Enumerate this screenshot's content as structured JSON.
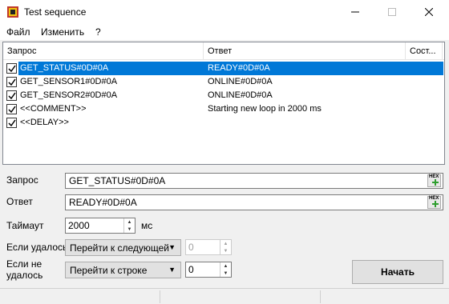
{
  "window": {
    "title": "Test sequence"
  },
  "menu": {
    "file": "Файл",
    "edit": "Изменить",
    "help": "?"
  },
  "list": {
    "columns": [
      "Запрос",
      "Ответ",
      "Сост..."
    ],
    "rows": [
      {
        "request": "GET_STATUS#0D#0A",
        "response": "READY#0D#0A",
        "checked": true,
        "selected": true
      },
      {
        "request": "GET_SENSOR1#0D#0A",
        "response": "ONLINE#0D#0A",
        "checked": true,
        "selected": false
      },
      {
        "request": "GET_SENSOR2#0D#0A",
        "response": "ONLINE#0D#0A",
        "checked": true,
        "selected": false
      },
      {
        "request": "<<COMMENT>>",
        "response": "Starting new loop in 2000 ms",
        "checked": true,
        "selected": false
      },
      {
        "request": "<<DELAY>>",
        "response": "",
        "checked": true,
        "selected": false
      }
    ]
  },
  "form": {
    "request_label": "Запрос",
    "request_value": "GET_STATUS#0D#0A",
    "response_label": "Ответ",
    "response_value": "READY#0D#0A",
    "timeout_label": "Таймаут",
    "timeout_value": "2000",
    "timeout_unit": "мс",
    "on_success_label": "Если удалось",
    "on_success_action": "Перейти к следующей",
    "on_success_value": "0",
    "on_fail_label_1": "Если не",
    "on_fail_label_2": "удалось",
    "on_fail_action": "Перейти к строке",
    "on_fail_value": "0",
    "hex_label": "HEX",
    "start_label": "Начать"
  }
}
